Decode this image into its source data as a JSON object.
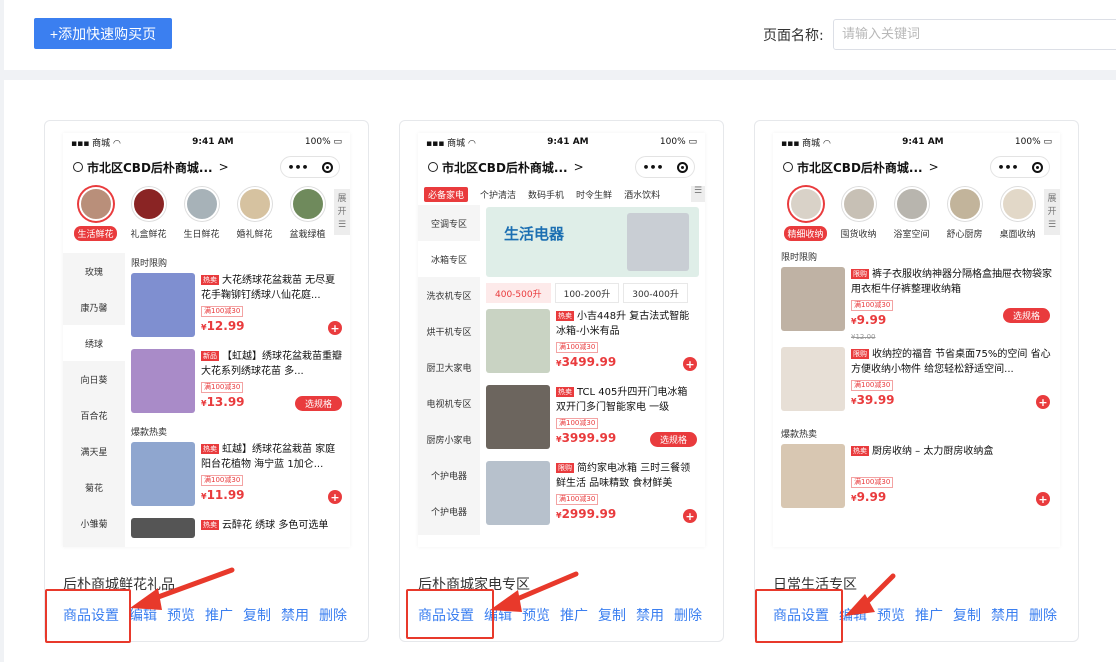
{
  "toolbar": {
    "add_label": "+添加快速购买页",
    "name_label": "页面名称:",
    "search_placeholder": "请输入关键词"
  },
  "actions": [
    "商品设置",
    "编辑",
    "预览",
    "推广",
    "复制",
    "禁用",
    "删除"
  ],
  "phone": {
    "carrier": "商城",
    "time": "9:41 AM",
    "battery": "100%",
    "location": "市北区CBD后朴商城...",
    "capsule_dots": "•••",
    "expand_label": "展开"
  },
  "cards": [
    {
      "title": "后朴商城鲜花礼品",
      "categories": [
        "生活鲜花",
        "礼盒鲜花",
        "生日鲜花",
        "婚礼鲜花",
        "盆栽绿植"
      ],
      "sidebar": [
        "玫瑰",
        "康乃馨",
        "绣球",
        "向日葵",
        "百合花",
        "满天星",
        "菊花",
        "小雏菊"
      ],
      "section1": "限时限购",
      "section2": "爆款热卖",
      "products": [
        {
          "tag": "热卖",
          "title": "大花绣球花盆栽苗 无尽夏花手鞠铆钉绣球八仙花庭...",
          "coupon": "满100减30",
          "price": "12.99",
          "btn": ""
        },
        {
          "tag": "新品",
          "title": "【虹越】绣球花盆栽苗重瓣大花系列绣球花苗 多...",
          "coupon": "满100减30",
          "price": "13.99",
          "btn": "选规格"
        },
        {
          "tag": "热卖",
          "title": "虹越】绣球花盆栽苗 家庭阳台花植物 海宁蓝 1加仑...",
          "coupon": "满100减30",
          "price": "11.99",
          "btn": ""
        },
        {
          "tag": "热卖",
          "title": "云醉花 绣球 多色可选单",
          "coupon": "",
          "price": "",
          "btn": ""
        }
      ]
    },
    {
      "title": "后朴商城家电专区",
      "tabs": [
        "必备家电",
        "个护清洁",
        "数码手机",
        "时令生鲜",
        "酒水饮料"
      ],
      "sidebar": [
        "空调专区",
        "冰箱专区",
        "洗衣机专区",
        "烘干机专区",
        "厨卫大家电",
        "电视机专区",
        "厨房小家电",
        "个护电器",
        "个护电器"
      ],
      "banner_title": "生活电器",
      "price_ranges": [
        "400-500升",
        "100-200升",
        "300-400升"
      ],
      "products": [
        {
          "tag": "热卖",
          "title": "小吉448升 复古法式智能冰箱-小米有品",
          "coupon": "满100减30",
          "price": "3499.99",
          "btn": ""
        },
        {
          "tag": "热卖",
          "title": "TCL 405升四开门电冰箱 双开门多门智能家电 一级",
          "coupon": "满100减30",
          "price": "3999.99",
          "btn": "选规格"
        },
        {
          "tag": "限购",
          "title": "简约家电冰箱 三时三餐领鲜生活 品味精致 食材鲜美",
          "coupon": "满100减30",
          "price": "2999.99",
          "btn": ""
        }
      ]
    },
    {
      "title": "日常生活专区",
      "categories": [
        "精细收纳",
        "囤货收纳",
        "浴室空间",
        "舒心厨房",
        "桌面收纳"
      ],
      "section1": "限时限购",
      "section2": "爆款热卖",
      "products": [
        {
          "tag": "限购",
          "title": "裤子衣服收纳神器分隔格盒抽屉衣物袋家用衣柜牛仔裤整理收纳箱",
          "coupon": "满100减30",
          "price": "9.99",
          "old_price": "¥12.00",
          "btn": "选规格"
        },
        {
          "tag": "限购",
          "title": "收纳控的福音 节省桌面75%的空间 省心方便收纳小物件 给您轻松舒适空间...",
          "coupon": "满100减30",
          "price": "39.99",
          "btn": ""
        },
        {
          "tag": "热卖",
          "title": "厨房收纳 – 太力厨房收纳盒",
          "coupon": "满100减30",
          "price": "9.99",
          "btn": ""
        }
      ]
    }
  ],
  "colors": {
    "accent": "#3b7ff0",
    "red": "#e93b3d",
    "highlight": "#e8392b"
  }
}
